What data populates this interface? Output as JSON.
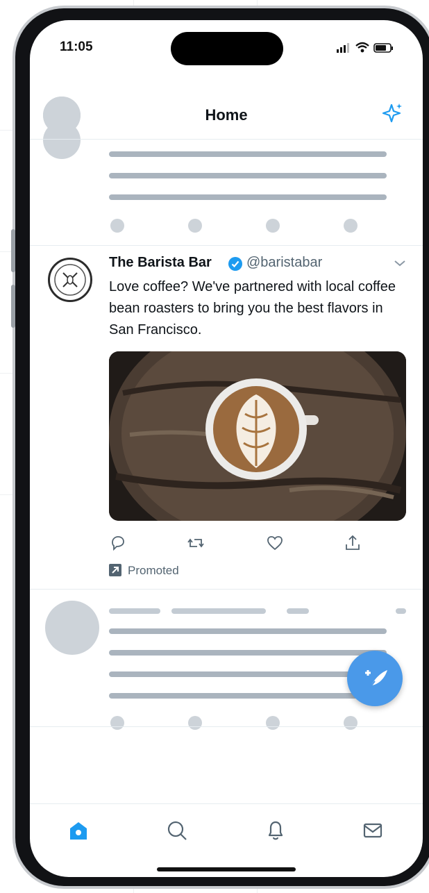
{
  "status_bar": {
    "time": "11:05"
  },
  "header": {
    "title": "Home"
  },
  "promoted_tweet": {
    "name": "The Barista Bar",
    "handle": "@baristabar",
    "text": "Love coffee? We've partnered with local coffee bean roasters to bring you the best flavors in San Francisco.",
    "promoted_label": "Promoted",
    "image_description": "latte art coffee cup on dark wooden table"
  },
  "icons": {
    "sparkle": "sparkle-icon",
    "verified": "verified-badge-icon",
    "caret": "chevron-down-icon",
    "reply": "reply-icon",
    "retweet": "retweet-icon",
    "like": "heart-icon",
    "share": "share-icon",
    "compose": "compose-tweet-icon",
    "nav": [
      "home-icon",
      "search-icon",
      "bell-icon",
      "mail-icon"
    ]
  },
  "colors": {
    "accent": "#1d9bf0",
    "fab": "#4a99e9",
    "text": "#0f1419",
    "muted": "#536471",
    "skeleton": "#aab4be"
  }
}
